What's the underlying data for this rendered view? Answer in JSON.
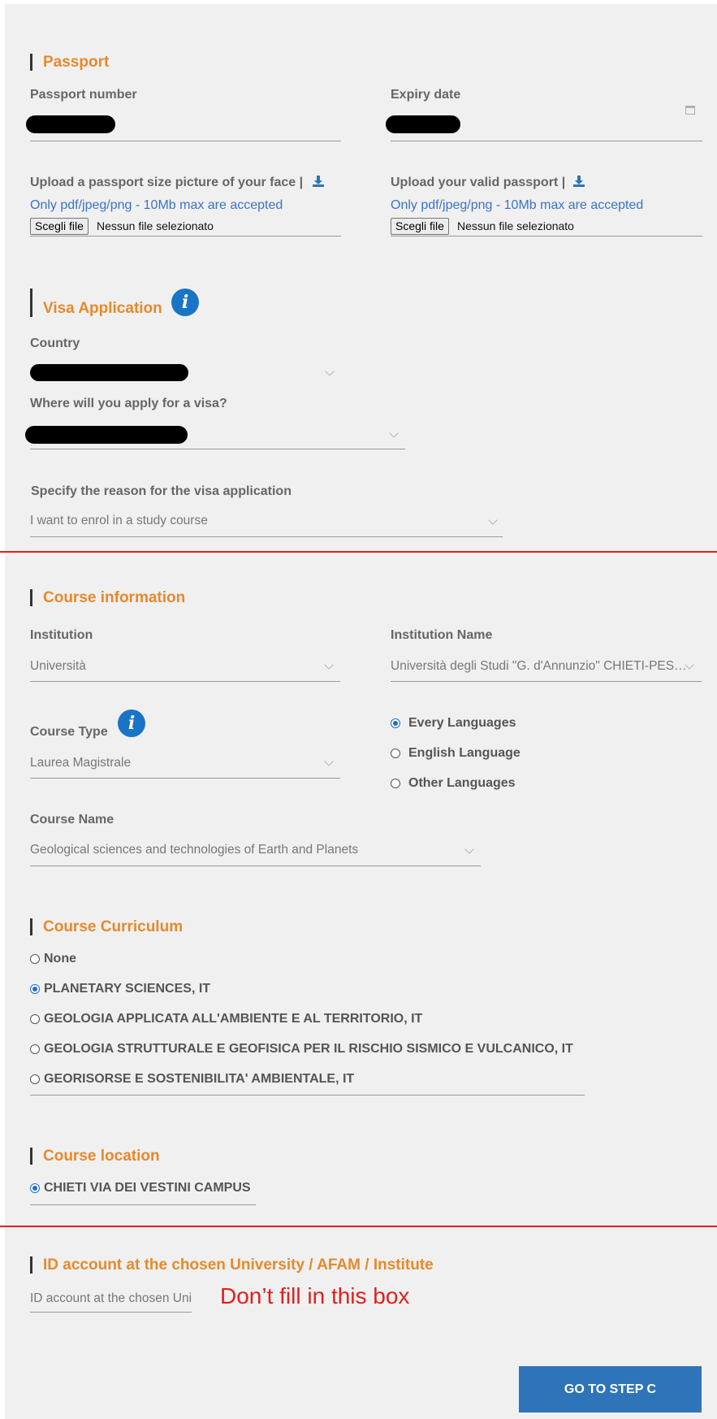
{
  "passport": {
    "title": "Passport",
    "number_label": "Passport number",
    "expiry_label": "Expiry date",
    "face_upload_label": "Upload a passport size picture of your face |",
    "passport_upload_label": "Upload your valid passport |",
    "accepted_hint": "Only pdf/jpeg/png - 10Mb max are accepted",
    "choose_file": "Scegli file",
    "no_file": "Nessun file selezionato"
  },
  "visa": {
    "title": "Visa Application",
    "country_label": "Country",
    "where_label": "Where will you apply for a visa?",
    "reason_label": "Specify the reason for the visa application",
    "reason_value": "I want to enrol in a study course"
  },
  "course": {
    "title": "Course information",
    "institution_label": "Institution",
    "institution_value": "Università",
    "institution_name_label": "Institution Name",
    "institution_name_value": "Università degli Studi \"G. d'Annunzio\" CHIETI-PESCARA",
    "type_label": "Course Type",
    "type_value": "Laurea Magistrale",
    "languages": [
      "Every Languages",
      "English Language",
      "Other Languages"
    ],
    "selected_language": "Every Languages",
    "name_label": "Course Name",
    "name_value": "Geological sciences and technologies of Earth and Planets"
  },
  "curriculum": {
    "title": "Course Curriculum",
    "options": [
      "None",
      "PLANETARY SCIENCES, IT",
      "GEOLOGIA APPLICATA ALL'AMBIENTE E AL TERRITORIO, IT",
      "GEOLOGIA STRUTTURALE E GEOFISICA PER IL RISCHIO SISMICO E VULCANICO, IT",
      "GEORISORSE E SOSTENIBILITA' AMBIENTALE, IT"
    ],
    "selected": "PLANETARY SCIENCES, IT"
  },
  "location": {
    "title": "Course location",
    "option": "CHIETI VIA DEI VESTINI CAMPUS"
  },
  "account": {
    "title": "ID account at the chosen University / AFAM / Institute",
    "placeholder": "ID account at the chosen University / AFAM / Institute",
    "annotation": "Don’t fill in this box"
  },
  "actions": {
    "next": "GO TO STEP C"
  },
  "colors": {
    "accent": "#e8892b",
    "button": "#2f74b9",
    "annotation": "#e0201f"
  }
}
